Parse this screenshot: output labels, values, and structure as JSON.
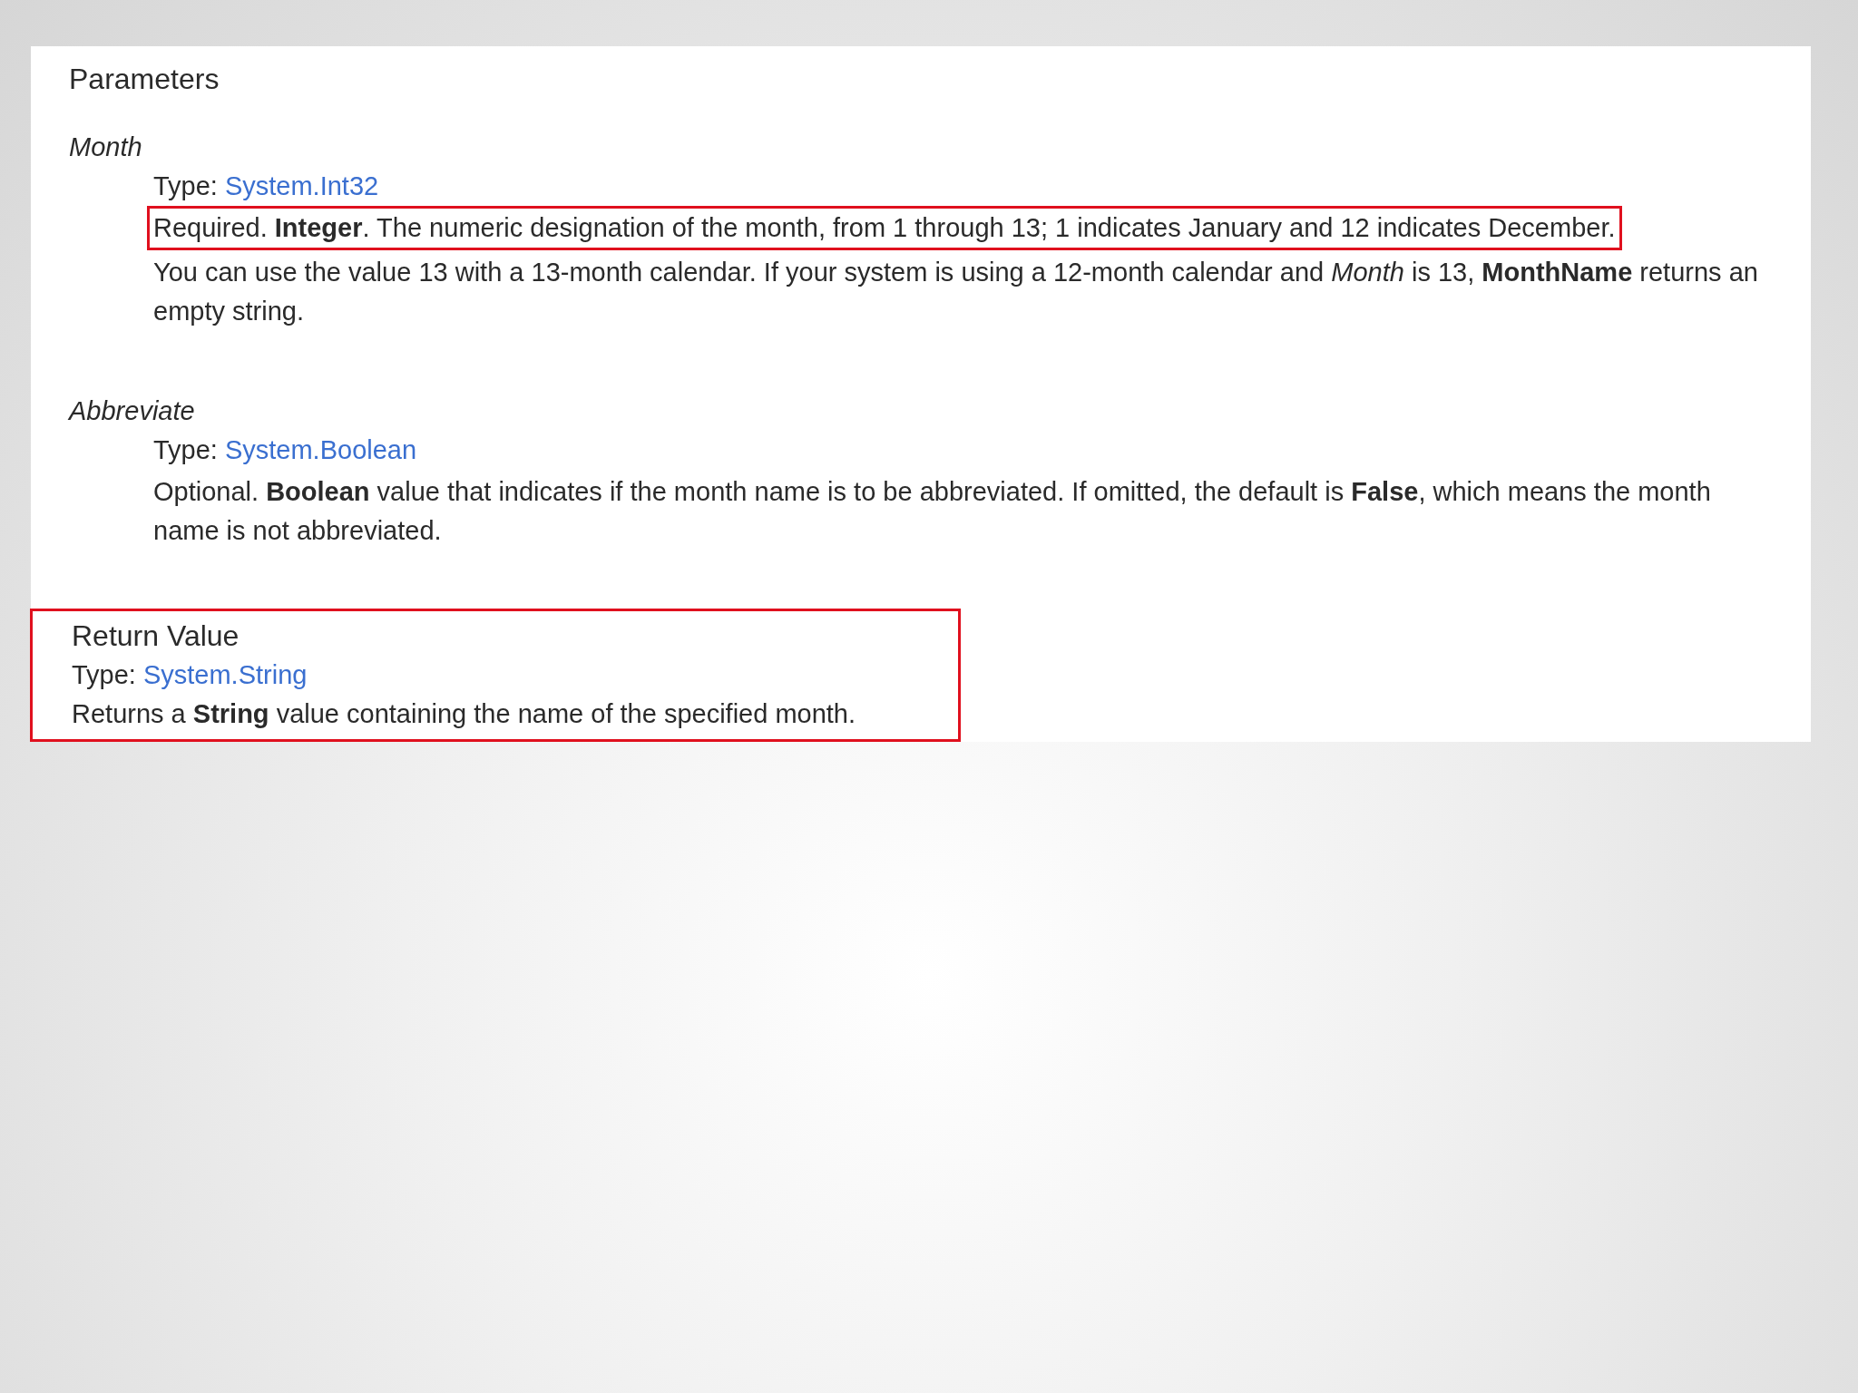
{
  "section_title": "Parameters",
  "parameters": [
    {
      "name": "Month",
      "type_label": "Type:",
      "type_link": "System.Int32",
      "paragraphs": [
        {
          "text": "Required. **Integer**. The numeric designation of the month, from 1 through 13; 1 indicates January and 12 indicates December.",
          "highlighted": true
        },
        {
          "text": "You can use the value 13 with a 13-month calendar. If your system is using a 12-month calendar and *Month* is 13, **MonthName** returns an empty string.",
          "highlighted": false
        }
      ]
    },
    {
      "name": "Abbreviate",
      "type_label": "Type:",
      "type_link": "System.Boolean",
      "paragraphs": [
        {
          "text": "Optional. **Boolean** value that indicates if the month name is to be abbreviated. If omitted, the default is **False**, which means the month name is not abbreviated.",
          "highlighted": false
        }
      ]
    }
  ],
  "return_value": {
    "heading": "Return Value",
    "type_label": "Type:",
    "type_link": "System.String",
    "description": "Returns a **String** value containing the name of the specified month.",
    "highlighted": true
  }
}
